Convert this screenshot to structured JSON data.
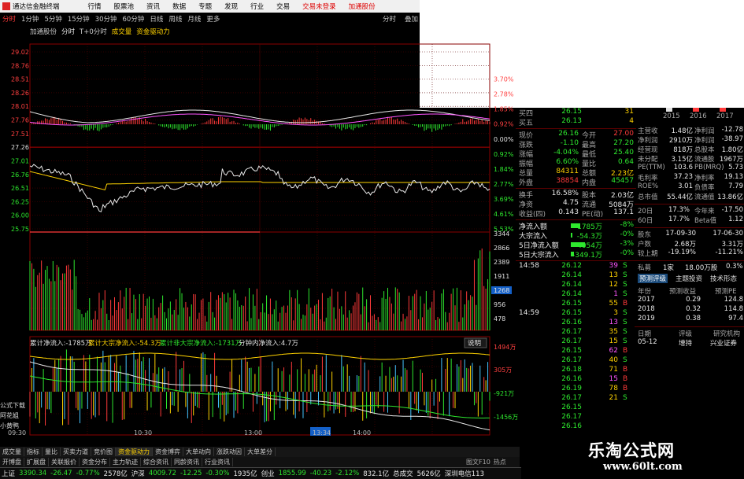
{
  "window": {
    "app_title": "通达信金融终端",
    "menus": [
      "行情",
      "股票池",
      "资讯",
      "数据",
      "专题",
      "发现",
      "行业",
      "交易"
    ],
    "login_status": "交易未登录",
    "stock_name_title": "加通股份"
  },
  "period_tabs": [
    "分时",
    "1分钟",
    "5分钟",
    "15分钟",
    "30分钟",
    "60分钟",
    "日线",
    "周线",
    "月线",
    "更多"
  ],
  "period_selected": "分时",
  "period_right": [
    "分时",
    "叠加"
  ],
  "info_bar": [
    "加通股份",
    "分时",
    "T+0分时",
    "成交量",
    "资金驱动力"
  ],
  "price_axis_left": [
    "29.02",
    "28.76",
    "28.51",
    "28.26",
    "28.01",
    "27.76",
    "27.51",
    "27.26",
    "27.01",
    "26.76",
    "26.51",
    "26.25",
    "26.00",
    "25.75"
  ],
  "pct_axis_right": [
    "3.70%",
    "2.78%",
    "1.85%",
    "0.92%",
    "0.00%",
    "0.92%",
    "1.84%",
    "2.77%",
    "3.69%",
    "4.61%",
    "5.53%"
  ],
  "volume_axis_right": [
    "3344",
    "2866",
    "2389",
    "1911",
    "1268",
    "956",
    "478"
  ],
  "fund_bar": {
    "label1": "累计净流入:-1785万",
    "label2": "累计大宗净流入:-54.3万",
    "label3": "累计非大宗净流入:-1731万",
    "label4": "分钟内净流入:4.7万",
    "button": "说明"
  },
  "fund_axis_right": [
    "1494万",
    "305万",
    "-921万",
    "-1456万"
  ],
  "time_axis": [
    "09:30",
    "10:30",
    "13:00",
    "13:34",
    "14:00"
  ],
  "left_side_links": [
    "公式下载",
    "阿花姐",
    "小黄鸭"
  ],
  "quote": {
    "bid_rows": [
      {
        "label": "买四",
        "price": "26.15",
        "vol": "31"
      },
      {
        "label": "买五",
        "price": "26.13",
        "vol": "4"
      }
    ],
    "stats": [
      {
        "l1": "现价",
        "v1": "26.16",
        "l2": "今开",
        "v2": "27.00"
      },
      {
        "l1": "涨跌",
        "v1": "-1.10",
        "l2": "最高",
        "v2": "27.20"
      },
      {
        "l1": "涨幅",
        "v1": "-4.04%",
        "l2": "最低",
        "v2": "25.40"
      },
      {
        "l1": "振幅",
        "v1": "6.60%",
        "l2": "量比",
        "v2": "0.64"
      },
      {
        "l1": "总量",
        "v1": "84311",
        "l2": "总额",
        "v2": "2.23亿"
      },
      {
        "l1": "外盘",
        "v1": "38854",
        "l2": "内盘",
        "v2": "45457"
      }
    ],
    "stats2": [
      {
        "l1": "换手",
        "v1": "16.58%",
        "l2": "股本",
        "v2": "2.03亿"
      },
      {
        "l1": "净资",
        "v1": "4.75",
        "l2": "流通",
        "v2": "5084万"
      },
      {
        "l1": "收益(四)",
        "v1": "0.143",
        "l2": "PE(动)",
        "v2": "137.1"
      }
    ],
    "flow": [
      {
        "label": "净流入额",
        "value": "-1785万",
        "pct": "-8%"
      },
      {
        "label": "大宗流入",
        "value": "-54.3万",
        "pct": "-0%"
      },
      {
        "label": "5日净流入额",
        "value": "-4054万",
        "pct": "-3%"
      },
      {
        "label": "5日大宗流入",
        "value": "-349.1万",
        "pct": "-0%"
      }
    ],
    "ticks": [
      {
        "time": "14:58",
        "price": "26.12",
        "vol": "39",
        "dir": "S"
      },
      {
        "time": "",
        "price": "26.14",
        "vol": "13",
        "dir": "S"
      },
      {
        "time": "",
        "price": "26.14",
        "vol": "12",
        "dir": "S"
      },
      {
        "time": "",
        "price": "26.14",
        "vol": "1",
        "dir": "S"
      },
      {
        "time": "",
        "price": "26.15",
        "vol": "55",
        "dir": "B"
      },
      {
        "time": "14:59",
        "price": "26.15",
        "vol": "3",
        "dir": "S"
      },
      {
        "time": "",
        "price": "26.16",
        "vol": "13",
        "dir": "S"
      },
      {
        "time": "",
        "price": "26.17",
        "vol": "35",
        "dir": "S"
      },
      {
        "time": "",
        "price": "26.17",
        "vol": "15",
        "dir": "S"
      },
      {
        "time": "",
        "price": "26.15",
        "vol": "62",
        "dir": "B"
      },
      {
        "time": "",
        "price": "26.17",
        "vol": "40",
        "dir": "S"
      },
      {
        "time": "",
        "price": "26.18",
        "vol": "71",
        "dir": "B"
      },
      {
        "time": "",
        "price": "26.16",
        "vol": "15",
        "dir": "B"
      },
      {
        "time": "",
        "price": "26.19",
        "vol": "78",
        "dir": "B"
      },
      {
        "time": "",
        "price": "26.17",
        "vol": "21",
        "dir": "S"
      },
      {
        "time": "",
        "price": "26.15",
        "vol": "",
        "dir": ""
      },
      {
        "time": "",
        "price": "26.17",
        "vol": "",
        "dir": ""
      },
      {
        "time": "",
        "price": "26.16",
        "vol": "",
        "dir": ""
      }
    ]
  },
  "f10": {
    "header_years": [
      "2015",
      "2016",
      "2017"
    ],
    "rows": [
      {
        "k": "主营收",
        "v": "1.48亿",
        "k2": "净利润",
        "v2": "-12.78"
      },
      {
        "k": "净利润",
        "v": "2910万",
        "k2": "净利润",
        "v2": "-38.97"
      },
      {
        "k": "经营现",
        "v": "818万",
        "k2": "总股本",
        "v2": "1.80亿"
      },
      {
        "k": "未分配",
        "v": "3.15亿",
        "k2": "流通股",
        "v2": "1967万"
      },
      {
        "k": "PE(TTM)",
        "v": "103.6",
        "k2": "PB(MRQ)",
        "v2": "5.73"
      },
      {
        "k": "毛利率",
        "v": "37.23",
        "k2": "净利率",
        "v2": "19.13"
      },
      {
        "k": "ROE%",
        "v": "3.01",
        "k2": "负债率",
        "v2": "7.79"
      },
      {
        "k": "总市值",
        "v": "55.44亿",
        "k2": "流通值",
        "v2": "13.86亿"
      }
    ],
    "rows2": [
      {
        "k": "20日",
        "v": "17.3%",
        "k2": "今年来",
        "v2": "-17.50"
      },
      {
        "k": "60日",
        "v": "17.7%",
        "k2": "Beta值",
        "v2": "1.12"
      }
    ],
    "rows3": [
      {
        "k": "股东",
        "v": "17-09-30",
        "v2": "17-06-30"
      },
      {
        "k": "户数",
        "v": "2.68万",
        "v2": "3.31万"
      },
      {
        "k": "较上期",
        "v": "-19.19%",
        "v2": "-11.21%"
      }
    ],
    "private": {
      "k": "私募",
      "v": "1家",
      "v2": "18.00万股",
      "v3": "0.3%"
    },
    "tabs": [
      "预测评级",
      "主题投资",
      "技术形态"
    ],
    "forecast_header": [
      "年份",
      "预测收益",
      "预测PE"
    ],
    "forecast": [
      {
        "y": "2017",
        "e": "0.29",
        "pe": "124.8"
      },
      {
        "y": "2018",
        "e": "0.32",
        "pe": "114.8"
      },
      {
        "y": "2019",
        "e": "0.38",
        "pe": "97.4"
      }
    ],
    "rating_header": [
      "日期",
      "评级",
      "研究机构"
    ],
    "rating": [
      {
        "d": "05-12",
        "r": "增持",
        "o": "兴业证券"
      }
    ]
  },
  "bottom_tabs": [
    "成交量",
    "指标",
    "量比",
    "买卖力道",
    "竞价图",
    "资金驱动力",
    "资金博弈",
    "大单动向",
    "涨跌动因",
    "大单差分"
  ],
  "bottom_tabs_active": "资金驱动力",
  "bottom_tabs2": [
    "开博盘",
    "扩展盘",
    "关联报价",
    "资金分布",
    "主力轨迹",
    "综合资讯",
    "同龄资讯",
    "行业资讯"
  ],
  "right_bottom_labels": [
    "图文F10",
    "热点"
  ],
  "status_bar": [
    {
      "t": "上证",
      "c": "wht"
    },
    {
      "t": "3390.34",
      "c": "grn"
    },
    {
      "t": "-26.47",
      "c": "grn"
    },
    {
      "t": "-0.77%",
      "c": "grn"
    },
    {
      "t": "2578亿",
      "c": "wht"
    },
    {
      "t": "沪深",
      "c": "wht"
    },
    {
      "t": "4009.72",
      "c": "grn"
    },
    {
      "t": "-12.25",
      "c": "grn"
    },
    {
      "t": "-0.30%",
      "c": "grn"
    },
    {
      "t": "1935亿",
      "c": "wht"
    },
    {
      "t": "创业",
      "c": "wht"
    },
    {
      "t": "1855.99",
      "c": "grn"
    },
    {
      "t": "-40.23",
      "c": "grn"
    },
    {
      "t": "-2.12%",
      "c": "grn"
    },
    {
      "t": "832.1亿",
      "c": "wht"
    },
    {
      "t": "总成交",
      "c": "wht"
    },
    {
      "t": "5626亿",
      "c": "wht"
    },
    {
      "t": "深圳电信113",
      "c": "wht"
    }
  ],
  "watermark": {
    "cn": "乐淘公式网",
    "url": "www.60lt.com"
  }
}
